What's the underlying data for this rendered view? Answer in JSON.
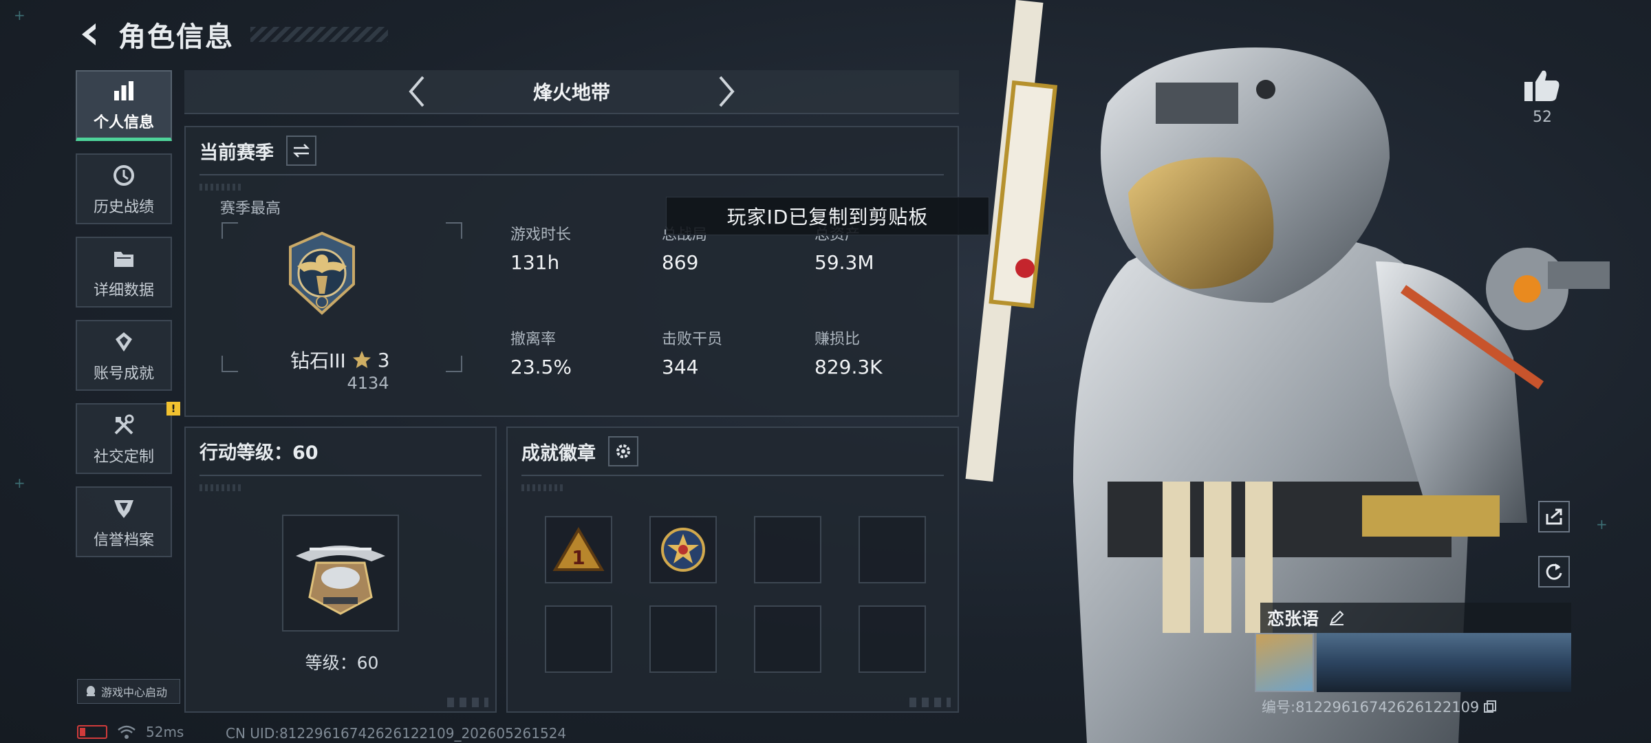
{
  "header": {
    "title": "角色信息"
  },
  "sidebar": {
    "items": [
      {
        "label": "个人信息",
        "icon": "bar-chart-icon",
        "active": true
      },
      {
        "label": "历史战绩",
        "icon": "history-clock-icon",
        "active": false
      },
      {
        "label": "详细数据",
        "icon": "folder-icon",
        "active": false
      },
      {
        "label": "账号成就",
        "icon": "achievement-icon",
        "active": false
      },
      {
        "label": "社交定制",
        "icon": "tools-icon",
        "active": false,
        "warning": "!"
      },
      {
        "label": "信誉档案",
        "icon": "credit-shield-icon",
        "active": false
      }
    ]
  },
  "launch": {
    "label": "游戏中心启动"
  },
  "status": {
    "ping": "52ms",
    "uid": "CN UID:81229616742626122109_202605261524"
  },
  "mode": {
    "title": "烽火地带"
  },
  "season": {
    "title": "当前赛季",
    "best_label": "赛季最高",
    "rank": {
      "name": "钻石III",
      "stars": "3",
      "points": "4134"
    },
    "stats": [
      {
        "label": "游戏时长",
        "value": "131h"
      },
      {
        "label": "总战局",
        "value": "869"
      },
      {
        "label": "总资产",
        "value": "59.3M"
      },
      {
        "label": "撤离率",
        "value": "23.5%"
      },
      {
        "label": "击败干员",
        "value": "344"
      },
      {
        "label": "赚损比",
        "value": "829.3K"
      }
    ]
  },
  "toast": {
    "text": "玩家ID已复制到剪贴板"
  },
  "level": {
    "title": "行动等级：60",
    "label": "等级：60"
  },
  "badges": {
    "title": "成就徽章",
    "slots": 8,
    "filled": 2
  },
  "like": {
    "count": "52"
  },
  "player": {
    "name": "恋张语",
    "id": "编号:81229616742626122109"
  },
  "colors": {
    "accent_green": "#4ed39a",
    "warning_yellow": "#f2c230",
    "battery_red": "#d13b3b"
  }
}
